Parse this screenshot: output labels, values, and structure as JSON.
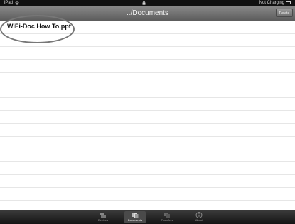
{
  "status_bar": {
    "device": "iPad",
    "battery_status": "Not Charging"
  },
  "nav_bar": {
    "title": "../Documents",
    "delete_label": "Delete"
  },
  "files": [
    {
      "name": "WiFi-Doc How To.ppt"
    }
  ],
  "tab_bar": {
    "tabs": [
      {
        "label": "Devices",
        "icon": "devices-icon",
        "selected": false
      },
      {
        "label": "Documents",
        "icon": "documents-icon",
        "selected": true
      },
      {
        "label": "Transfers",
        "icon": "transfers-icon",
        "selected": false
      },
      {
        "label": "About",
        "icon": "info-icon",
        "selected": false
      }
    ]
  },
  "colors": {
    "nav_bar": "#6e6e6e",
    "status_bar": "#111111",
    "tab_bar": "#1e1e1e",
    "highlight": "#777777"
  }
}
